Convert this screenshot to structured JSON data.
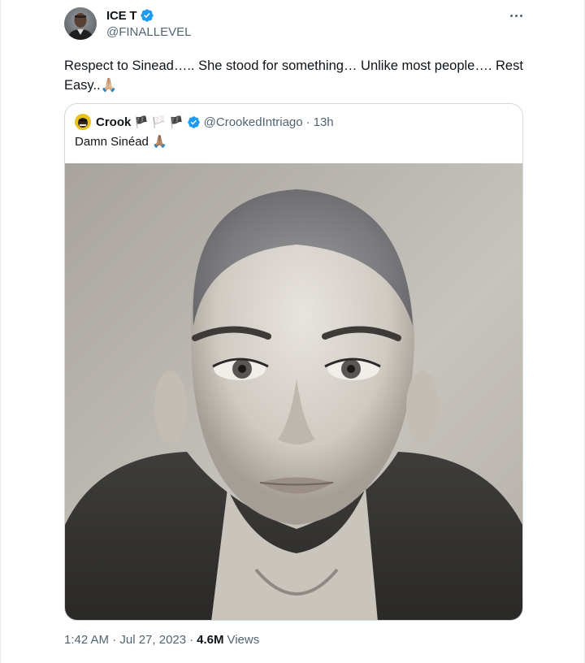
{
  "tweet": {
    "author": {
      "display_name": "ICE T",
      "handle": "@FINALLEVEL",
      "verified_icon": "verified-badge-icon"
    },
    "text": "Respect to Sinead….. She stood for something… Unlike most people…. Rest Easy..🙏🏼",
    "more_icon": "more-options-icon",
    "timestamp": "1:42 AM · Jul 27, 2023",
    "separator": "·",
    "views_count": "4.6M",
    "views_label": "Views"
  },
  "quote": {
    "display_name": "Crook",
    "flags": [
      "🏴",
      "🏳️",
      "🏴"
    ],
    "handle": "@CrookedIntriago",
    "separator": "·",
    "time": "13h",
    "text": "Damn Sinéad 🙏🏽",
    "media_icon": "portrait-photo-image"
  },
  "colors": {
    "primary_text": "#0f1419",
    "secondary_text": "#536471",
    "verified_blue": "#1d9bf0",
    "border": "#cfd9de"
  }
}
